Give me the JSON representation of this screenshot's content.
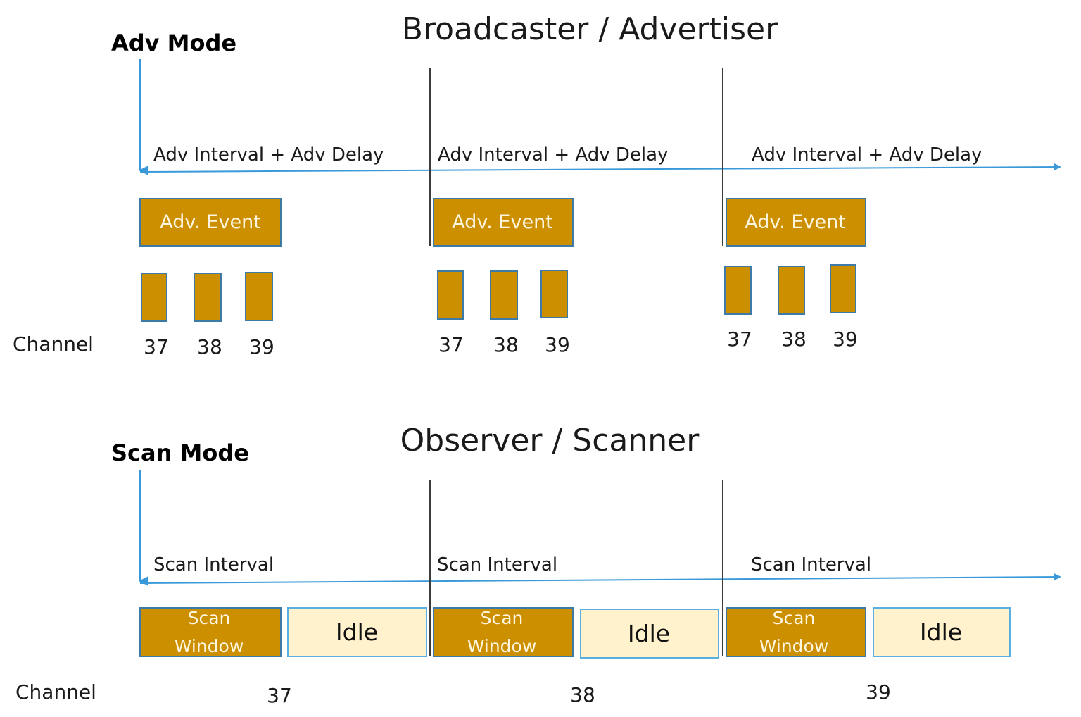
{
  "colors": {
    "gold": "#cc8f00",
    "gold_border": "#3d7aa8",
    "idle_fill": "#fff2cc",
    "idle_border": "#5aaee0",
    "timeline": "#3a9ad9",
    "divider": "#3c3c3c"
  },
  "advertiser": {
    "title": "Broadcaster / Advertiser",
    "mode_label": "Adv Mode",
    "channel_label": "Channel",
    "intervals": [
      {
        "label": "Adv Interval + Adv Delay"
      },
      {
        "label": "Adv Interval + Adv Delay"
      },
      {
        "label": "Adv Interval + Adv Delay"
      }
    ],
    "events": [
      {
        "label": "Adv. Event",
        "channels": [
          "37",
          "38",
          "39"
        ]
      },
      {
        "label": "Adv. Event",
        "channels": [
          "37",
          "38",
          "39"
        ]
      },
      {
        "label": "Adv. Event",
        "channels": [
          "37",
          "38",
          "39"
        ]
      }
    ]
  },
  "scanner": {
    "title": "Observer / Scanner",
    "mode_label": "Scan Mode",
    "channel_label": "Channel",
    "intervals": [
      {
        "label": "Scan Interval",
        "window_label_1": "Scan",
        "window_label_2": "Window",
        "idle_label": "Idle",
        "channel": "37"
      },
      {
        "label": "Scan Interval",
        "window_label_1": "Scan",
        "window_label_2": "Window",
        "idle_label": "Idle",
        "channel": "38"
      },
      {
        "label": "Scan Interval",
        "window_label_1": "Scan",
        "window_label_2": "Window",
        "idle_label": "Idle",
        "channel": "39"
      }
    ]
  }
}
